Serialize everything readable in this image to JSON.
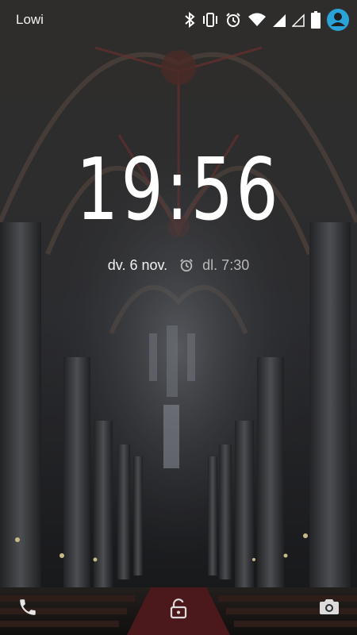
{
  "status_bar": {
    "carrier": "Lowi",
    "icons": [
      "bluetooth-icon",
      "vibrate-icon",
      "alarm-icon",
      "wifi-icon",
      "signal-icon",
      "signal-empty-icon",
      "battery-icon",
      "user-avatar-icon"
    ]
  },
  "lockscreen": {
    "time": "19:56",
    "date": "dv. 6 nov.",
    "next_alarm": "dl. 7:30"
  },
  "bottom_bar": {
    "left_icon": "phone-icon",
    "center_icon": "unlock-icon",
    "right_icon": "camera-icon"
  },
  "colors": {
    "avatar": "#2aa3d8",
    "text": "#ffffff",
    "secondary_text": "#b9b9b9"
  }
}
